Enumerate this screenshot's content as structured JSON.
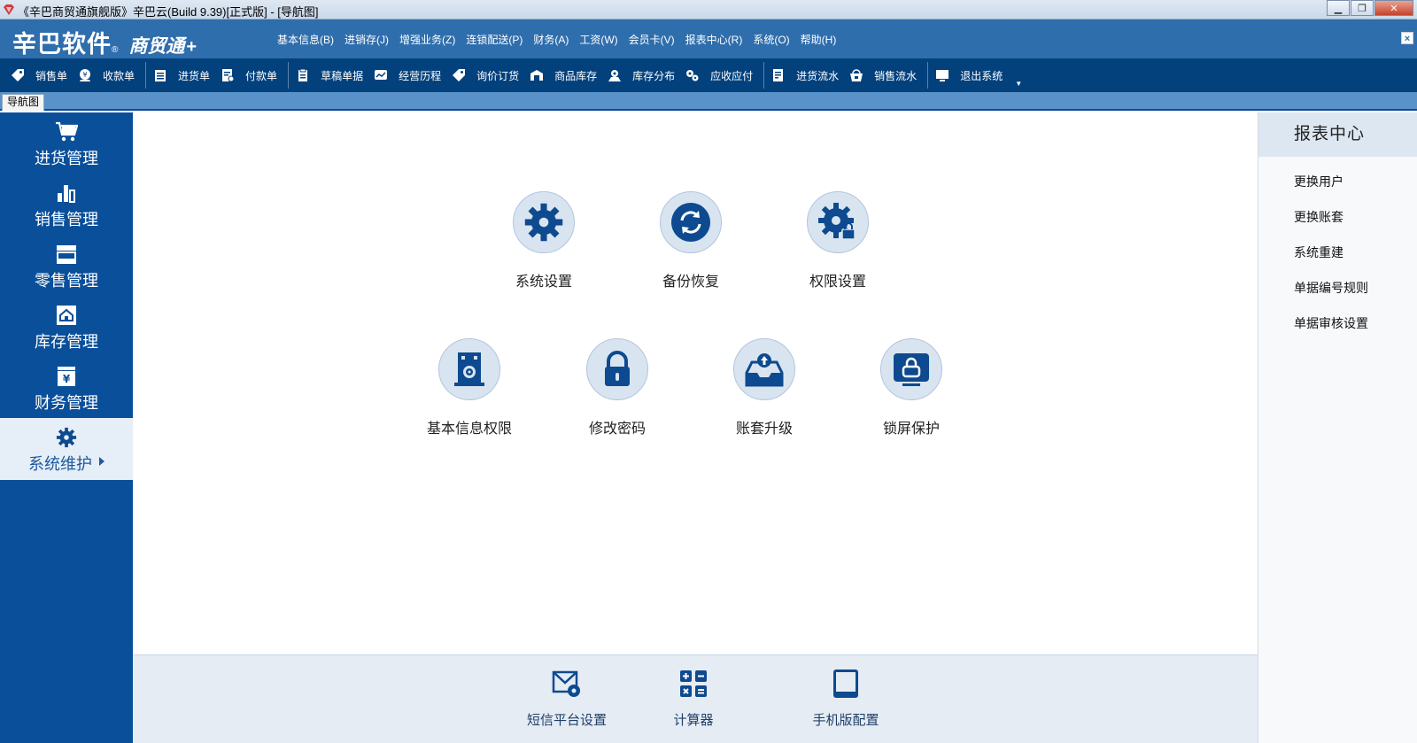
{
  "window": {
    "title": "《辛巴商贸通旗舰版》辛巴云(Build 9.39)[正式版] - [导航图]"
  },
  "header": {
    "logo_brand": "辛巴软件",
    "logo_reg": "®",
    "logo_product": "商贸通",
    "logo_plus": "+",
    "close_label": "×"
  },
  "menu": [
    {
      "label": "基本信息(B)"
    },
    {
      "label": "进销存(J)"
    },
    {
      "label": "增强业务(Z)"
    },
    {
      "label": "连锁配送(P)"
    },
    {
      "label": "财务(A)"
    },
    {
      "label": "工资(W)"
    },
    {
      "label": "会员卡(V)"
    },
    {
      "label": "报表中心(R)"
    },
    {
      "label": "系统(O)"
    },
    {
      "label": "帮助(H)"
    }
  ],
  "toolbar": [
    {
      "label": "销售单",
      "icon": "tag-icon"
    },
    {
      "label": "收款单",
      "icon": "receive-icon"
    },
    {
      "label": "进货单",
      "icon": "purchase-doc-icon"
    },
    {
      "label": "付款单",
      "icon": "payment-doc-icon"
    },
    {
      "label": "草稿单据",
      "icon": "draft-icon"
    },
    {
      "label": "经营历程",
      "icon": "history-icon"
    },
    {
      "label": "询价订货",
      "icon": "inquiry-tag-icon"
    },
    {
      "label": "商品库存",
      "icon": "stock-icon"
    },
    {
      "label": "库存分布",
      "icon": "distribution-icon"
    },
    {
      "label": "应收应付",
      "icon": "gears-icon"
    },
    {
      "label": "进货流水",
      "icon": "purchase-flow-icon"
    },
    {
      "label": "销售流水",
      "icon": "basket-icon"
    },
    {
      "label": "退出系统",
      "icon": "monitor-icon"
    }
  ],
  "tab": {
    "label": "导航图"
  },
  "sidebar": [
    {
      "label": "进货管理",
      "icon": "cart-icon",
      "active": false
    },
    {
      "label": "销售管理",
      "icon": "bar-chart-icon",
      "active": false
    },
    {
      "label": "零售管理",
      "icon": "store-icon",
      "active": false
    },
    {
      "label": "库存管理",
      "icon": "warehouse-icon",
      "active": false
    },
    {
      "label": "财务管理",
      "icon": "yen-icon",
      "active": false
    },
    {
      "label": "系统维护",
      "icon": "gear-icon",
      "active": true
    }
  ],
  "functions": [
    {
      "label": "系统设置",
      "icon": "gear-icon"
    },
    {
      "label": "备份恢复",
      "icon": "sync-icon"
    },
    {
      "label": "权限设置",
      "icon": "gear-lock-icon"
    },
    {
      "label": "基本信息权限",
      "icon": "building-gear-icon"
    },
    {
      "label": "修改密码",
      "icon": "padlock-icon"
    },
    {
      "label": "账套升级",
      "icon": "inbox-upload-icon"
    },
    {
      "label": "锁屏保护",
      "icon": "screen-lock-icon"
    }
  ],
  "tools": [
    {
      "label": "短信平台设置",
      "icon": "sms-settings-icon"
    },
    {
      "label": "计算器",
      "icon": "calculator-icon"
    },
    {
      "label": "手机版配置",
      "icon": "tablet-icon"
    }
  ],
  "report_center": {
    "title": "报表中心",
    "items": [
      {
        "label": "更换用户"
      },
      {
        "label": "更换账套"
      },
      {
        "label": "系统重建"
      },
      {
        "label": "单据编号规则"
      },
      {
        "label": "单据审核设置"
      }
    ]
  },
  "colors": {
    "header": "#2f6ead",
    "toolbar": "#03417d",
    "sidebar": "#0a4f9a",
    "icon_blue": "#0d4a8f",
    "circle_bg": "#d9e4f1"
  }
}
